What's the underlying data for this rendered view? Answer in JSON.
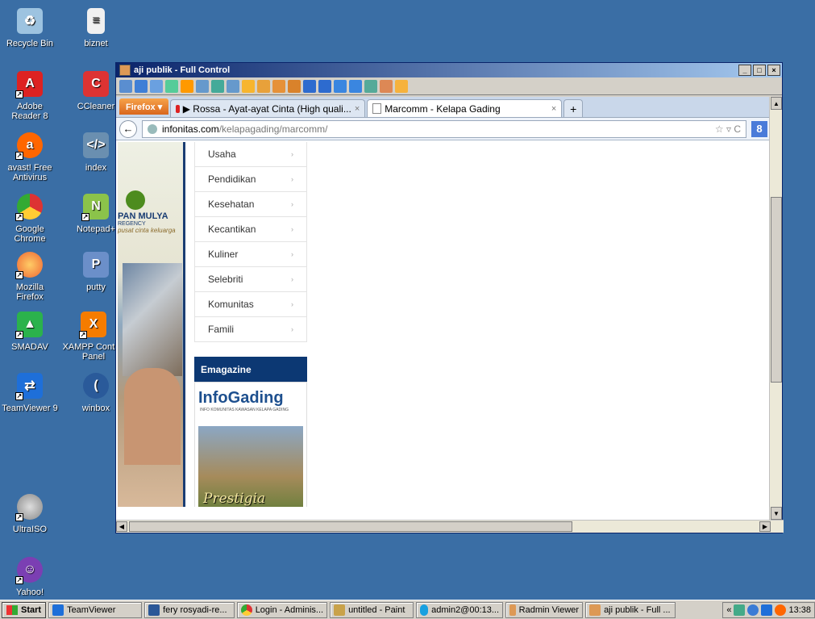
{
  "desktop": {
    "icons": [
      {
        "label": "Recycle Bin"
      },
      {
        "label": "biznet"
      },
      {
        "label": "Adobe Reader 8"
      },
      {
        "label": "CCleaner"
      },
      {
        "label": "avast! Free Antivirus"
      },
      {
        "label": "index"
      },
      {
        "label": "Google Chrome"
      },
      {
        "label": "Notepad+"
      },
      {
        "label": "Mozilla Firefox"
      },
      {
        "label": "putty"
      },
      {
        "label": "SMADAV"
      },
      {
        "label": "XAMPP Control Panel"
      },
      {
        "label": "TeamViewer 9"
      },
      {
        "label": "winbox"
      },
      {
        "label": "UltraISO"
      },
      {
        "label": "Yahoo!"
      }
    ]
  },
  "remote_window": {
    "title": "aji publik - Full Control",
    "controls": [
      "_",
      "□",
      "×"
    ]
  },
  "firefox": {
    "menu_button": "Firefox ▾",
    "tabs": [
      {
        "label": "▶ Rossa - Ayat-ayat Cinta (High quali...",
        "close": "×"
      },
      {
        "label": "Marcomm - Kelapa Gading",
        "close": "×"
      }
    ],
    "new_tab": "+",
    "url_domain": "infonitas.com",
    "url_path": "/kelapagading/marcomm/",
    "url_icons": "☆ ▿ C",
    "search_icon_letter": "8"
  },
  "page": {
    "logo_name": "PAN MULYA",
    "logo_sub": "REGENCY",
    "logo_tagline": "pusat cinta keluarga",
    "menu_items": [
      "Usaha",
      "Pendidikan",
      "Kesehatan",
      "Kecantikan",
      "Kuliner",
      "Selebriti",
      "Komunitas",
      "Famili"
    ],
    "menu_arrow": "›",
    "emagazine_header": "Emagazine",
    "magazine_title": "InfoGading",
    "magazine_subtitle": "INFO KOMUNITAS KAWASAN KELAPA GADING",
    "magazine_cover_text": "Prestigia"
  },
  "taskbar": {
    "start": "Start",
    "buttons": [
      "TeamViewer",
      "fery rosyadi-re...",
      "Login - Adminis...",
      "untitled - Paint",
      "admin2@00:13...",
      "Radmin Viewer",
      "aji publik - Full ..."
    ],
    "tray_chevron": "«",
    "clock": "13:38"
  }
}
